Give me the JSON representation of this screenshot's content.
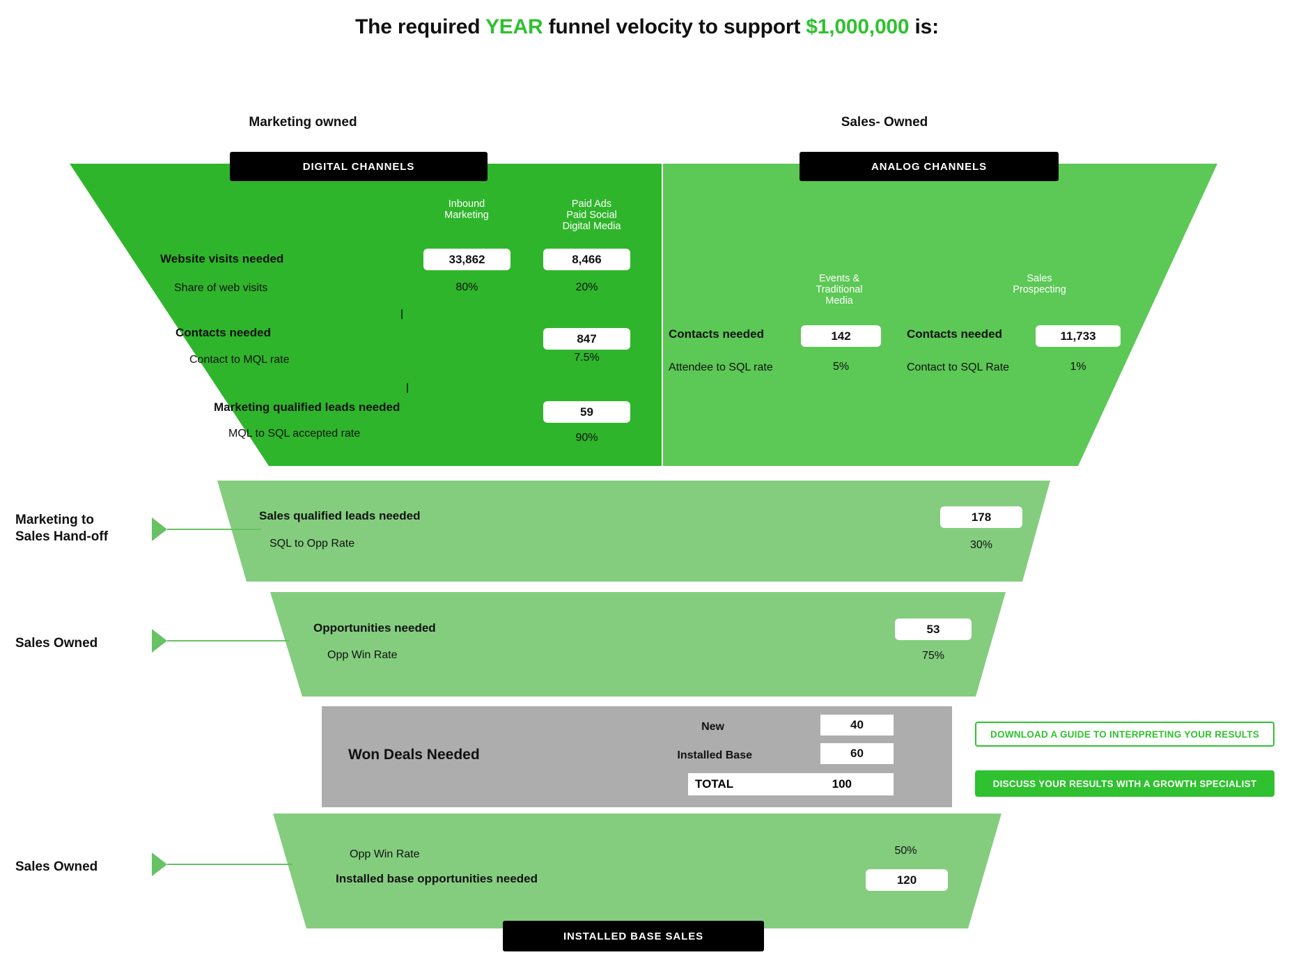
{
  "title": {
    "part1": "The required ",
    "accent1": "YEAR",
    "part2": " funnel velocity to support ",
    "accent2": "$1,000,000",
    "part3": " is:"
  },
  "colors": {
    "brand_green": "#2fc12f",
    "dark_green_panel": "#2fb52b",
    "mid_green_panel": "#5cc855",
    "light_green_panel": "#84cd7f",
    "grey_panel": "#adadad",
    "black_chip": "#000000"
  },
  "headers": {
    "marketing_owned": "Marketing owned",
    "sales_owned": "Sales- Owned",
    "digital_channels": "DIGITAL CHANNELS",
    "analog_channels": "ANALOG CHANNELS",
    "installed_base_sales": "INSTALLED BASE SALES"
  },
  "digital": {
    "columns": [
      {
        "name": "Inbound\nMarketing"
      },
      {
        "name": "Paid Ads\nPaid Social\nDigital Media"
      }
    ],
    "rows": [
      {
        "label": "Website visits needed",
        "sub_label": "Share of web visits",
        "inbound_value": "33,862",
        "inbound_pct": "80%",
        "paid_value": "8,466",
        "paid_pct": "20%"
      },
      {
        "label": "Contacts needed",
        "sub_label": "Contact to MQL rate",
        "paid_value": "847",
        "paid_pct": "7.5%"
      },
      {
        "label": "Marketing qualified leads needed",
        "sub_label": "MQL to SQL accepted rate",
        "paid_value": "59",
        "paid_pct": "90%"
      }
    ]
  },
  "analog": {
    "columns": [
      {
        "name": "Events &\nTraditional\nMedia"
      },
      {
        "name": "Sales\nProspecting"
      }
    ],
    "events": {
      "label": "Contacts needed",
      "value": "142",
      "sub_label": "Attendee to SQL rate",
      "pct": "5%"
    },
    "prospecting": {
      "label": "Contacts needed",
      "value": "11,733",
      "sub_label": "Contact to SQL Rate",
      "pct": "1%"
    }
  },
  "handoff": {
    "side_label_line1": "Marketing to",
    "side_label_line2": "Sales Hand-off",
    "label": "Sales qualified leads needed",
    "value": "178",
    "sub_label": "SQL to Opp Rate",
    "pct": "30%"
  },
  "opportunities": {
    "side_label": "Sales Owned",
    "label": "Opportunities needed",
    "value": "53",
    "sub_label": "Opp Win Rate",
    "pct": "75%"
  },
  "won_deals": {
    "title": "Won Deals Needed",
    "rows": [
      {
        "label": "New",
        "value": "40"
      },
      {
        "label": "Installed Base",
        "value": "60"
      }
    ],
    "total_label": "TOTAL",
    "total_value": "100"
  },
  "installed_base": {
    "side_label": "Sales Owned",
    "sub_label": "Opp Win Rate",
    "pct": "50%",
    "label": "Installed base opportunities needed",
    "value": "120"
  },
  "ctas": {
    "download": "DOWNLOAD A GUIDE TO INTERPRETING YOUR RESULTS",
    "discuss": "DISCUSS YOUR RESULTS WITH A GROWTH SPECIALIST"
  }
}
